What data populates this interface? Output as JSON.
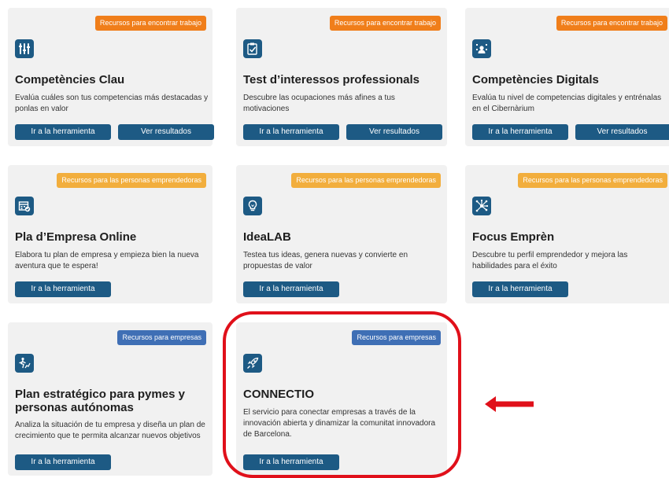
{
  "cards": [
    {
      "badge": "Recursos para encontrar trabajo",
      "icon": "sliders-icon",
      "title": "Competències Clau",
      "description": "Evalúa cuáles son tus competencias más destacadas y ponlas en valor",
      "primary_button": "Ir a la herramienta",
      "secondary_button": "Ver resultados"
    },
    {
      "badge": "Recursos para encontrar trabajo",
      "icon": "checklist-icon",
      "title": "Test d’interessos professionals",
      "description": "Descubre las ocupaciones más afines a tus motivaciones",
      "primary_button": "Ir a la herramienta",
      "secondary_button": "Ver resultados"
    },
    {
      "badge": "Recursos para encontrar trabajo",
      "icon": "digital-person-icon",
      "title": "Competències Digitals",
      "description": "Evalúa tu nivel de competencias digitales y entrénalas en el Cibernàrium",
      "primary_button": "Ir a la herramienta",
      "secondary_button": "Ver resultados"
    },
    {
      "badge": "Recursos para las personas emprendedoras",
      "icon": "calendar-check-icon",
      "title": "Pla d’Empresa Online",
      "description": "Elabora tu plan de empresa y empieza bien la nueva aventura que te espera!",
      "primary_button": "Ir a la herramienta"
    },
    {
      "badge": "Recursos para las personas emprendedoras",
      "icon": "lightbulb-icon",
      "title": "IdeaLAB",
      "description": "Testea tus ideas, genera nuevas y convierte en propuestas de valor",
      "primary_button": "Ir a la herramienta"
    },
    {
      "badge": "Recursos para las personas emprendedoras",
      "icon": "network-icon",
      "title": "Focus Emprèn",
      "description": "Descubre tu perfil emprendedor y mejora las habilidades para el éxito",
      "primary_button": "Ir a la herramienta"
    },
    {
      "badge": "Recursos para empresas",
      "icon": "runner-chart-icon",
      "title": "Plan estratégico para pymes y personas autónomas",
      "description": "Analiza la situación de tu empresa y diseña un plan de crecimiento que te permita alcanzar nuevos objetivos",
      "primary_button": "Ir a la herramienta"
    },
    {
      "badge": "Recursos para empresas",
      "icon": "rocket-icon",
      "title": "CONNECTIO",
      "description": "El servicio para conectar empresas a través de la innovación abierta y dinamizar la comunitat innovadora de Barcelona.",
      "primary_button": "Ir a la herramienta"
    }
  ],
  "colors": {
    "primary_button": "#1d5a84",
    "badge_jobs": "#f07e1a",
    "badge_entrepreneurs": "#f2ae3d",
    "badge_companies": "#3f6fb5",
    "highlight": "#e0101a"
  }
}
